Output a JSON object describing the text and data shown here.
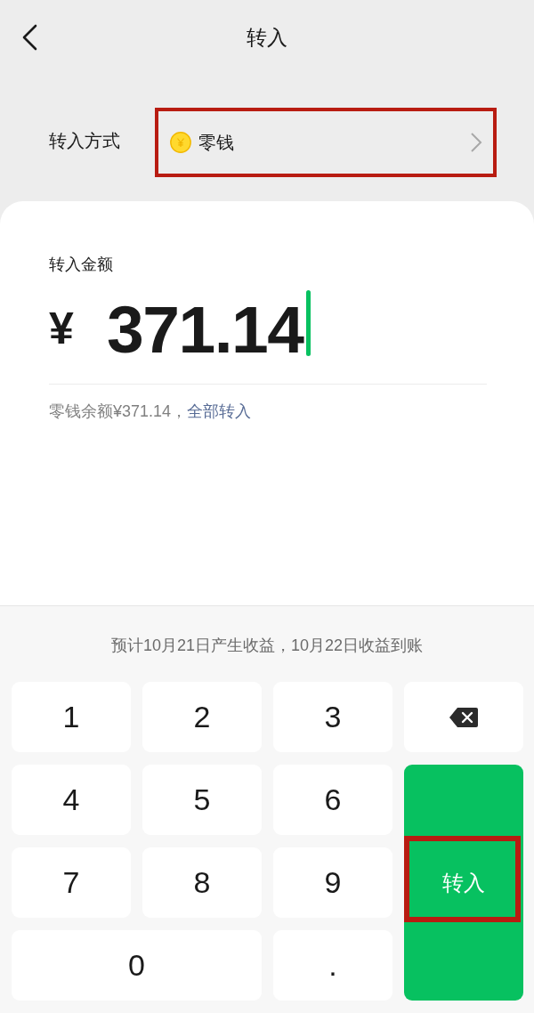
{
  "header": {
    "title": "转入"
  },
  "transfer_method": {
    "label": "转入方式",
    "value": "零钱",
    "highlighted": true
  },
  "amount": {
    "label": "转入金额",
    "currency": "¥",
    "value": "371.14",
    "focused": true
  },
  "balance": {
    "text": "零钱余额¥371.14，",
    "link": "全部转入"
  },
  "keypad": {
    "hint": "预计10月21日产生收益，10月22日收益到账",
    "keys": [
      {
        "kind": "digit",
        "label": "1"
      },
      {
        "kind": "digit",
        "label": "2"
      },
      {
        "kind": "digit",
        "label": "3"
      },
      {
        "kind": "backspace"
      },
      {
        "kind": "digit",
        "label": "4"
      },
      {
        "kind": "digit",
        "label": "5"
      },
      {
        "kind": "digit",
        "label": "6"
      },
      {
        "kind": "digit",
        "label": "7"
      },
      {
        "kind": "digit",
        "label": "8"
      },
      {
        "kind": "digit",
        "label": "9"
      },
      {
        "kind": "digit",
        "label": "0",
        "wide": true
      },
      {
        "kind": "point",
        "label": "."
      }
    ],
    "confirm": {
      "label": "转入",
      "highlighted": true
    }
  }
}
